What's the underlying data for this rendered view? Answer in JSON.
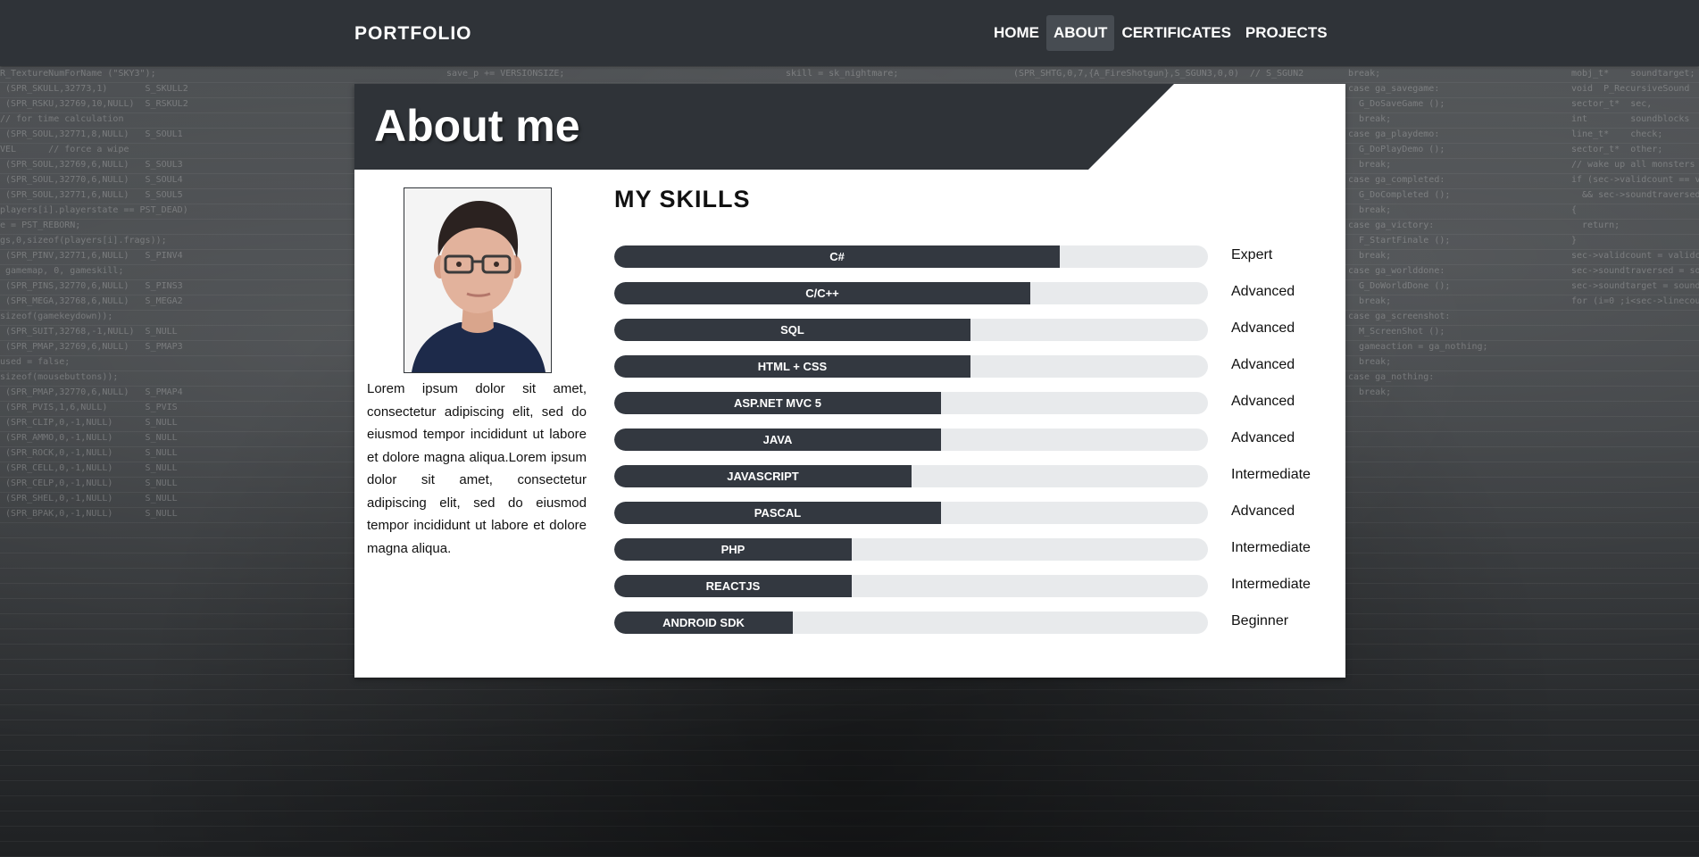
{
  "navbar": {
    "brand": "PORTFOLIO",
    "items": [
      {
        "label": "HOME",
        "active": false
      },
      {
        "label": "ABOUT",
        "active": true
      },
      {
        "label": "CERTIFICATES",
        "active": false
      },
      {
        "label": "PROJECTS",
        "active": false
      }
    ]
  },
  "about": {
    "title": "About me",
    "bio": "Lorem ipsum dolor sit amet, consectetur adipiscing elit, sed do eiusmod tempor incididunt ut labore et dolore magna aliqua.Lorem ipsum dolor sit amet, consectetur adipiscing elit, sed do eiusmod tempor incididunt ut labore et dolore magna aliqua."
  },
  "skills": {
    "title": "MY SKILLS",
    "items": [
      {
        "name": "C#",
        "level": "Expert",
        "percent": 75
      },
      {
        "name": "C/C++",
        "level": "Advanced",
        "percent": 70
      },
      {
        "name": "SQL",
        "level": "Advanced",
        "percent": 60
      },
      {
        "name": "HTML + CSS",
        "level": "Advanced",
        "percent": 60
      },
      {
        "name": "ASP.NET MVC 5",
        "level": "Advanced",
        "percent": 55
      },
      {
        "name": "JAVA",
        "level": "Advanced",
        "percent": 55
      },
      {
        "name": "JAVASCRIPT",
        "level": "Intermediate",
        "percent": 50
      },
      {
        "name": "PASCAL",
        "level": "Advanced",
        "percent": 55
      },
      {
        "name": "PHP",
        "level": "Intermediate",
        "percent": 40
      },
      {
        "name": "REACTJS",
        "level": "Intermediate",
        "percent": 40
      },
      {
        "name": "ANDROID SDK",
        "level": "Beginner",
        "percent": 30
      }
    ]
  },
  "colors": {
    "navbar": "#2f3338",
    "bar_fill": "#333840",
    "bar_track": "#e8eaec",
    "header": "#2f3338"
  }
}
